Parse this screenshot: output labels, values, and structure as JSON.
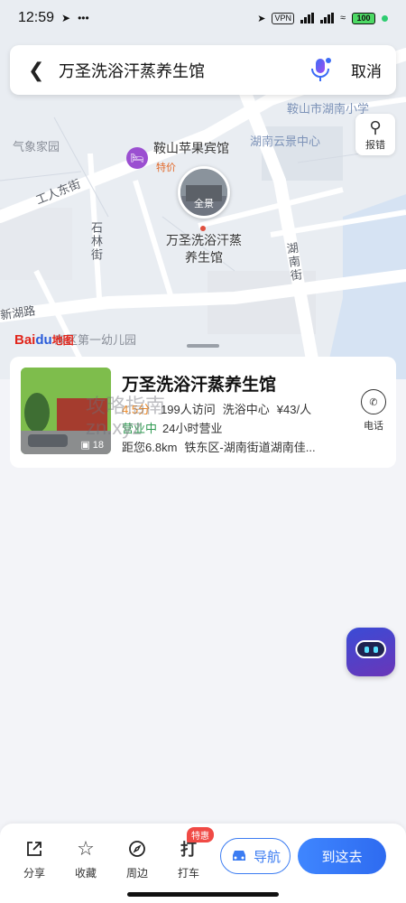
{
  "status_bar": {
    "time": "12:59",
    "left_icons": [
      "navigation-icon",
      "more-icon"
    ],
    "vpn_label": "VPN",
    "battery": "100"
  },
  "search": {
    "query": "万圣洗浴汗蒸养生馆",
    "cancel_label": "取消"
  },
  "map": {
    "report_label": "报错",
    "labels": {
      "weather_park": "气象家园",
      "school": "鞍山市湖南小学",
      "community": "湖南云景中心",
      "street_gongren": "工人东街",
      "street_shilin": "石林街",
      "street_hunan": "湖南街",
      "road_xinhu": "新湖路",
      "kindergarten": "东区第一幼儿园"
    },
    "hotel": {
      "name": "鞍山苹果宾馆",
      "tag": "特价"
    },
    "poi": {
      "name": "万圣洗浴汗蒸养生馆",
      "pano_label": "全景"
    },
    "logo_text": "Bai",
    "logo_paw": "du",
    "logo_suffix": "地图"
  },
  "result": {
    "title": "万圣洗浴汗蒸养生馆",
    "rating": "4.5分",
    "visits": "199人访问",
    "category": "洗浴中心",
    "price": "¥43/人",
    "hours_tag": "营业中",
    "hours": "24小时营业",
    "distance": "距您6.8km",
    "address": "铁东区-湖南街道湖南佳...",
    "photo_count": "18",
    "phone_label": "电话"
  },
  "watermark": {
    "line1": "攻略指南",
    "line2": "zn.xyz"
  },
  "bottom_bar": {
    "share_label": "分享",
    "favorite_label": "收藏",
    "nearby_label": "周边",
    "taxi_label": "打车",
    "promo_badge": "特惠",
    "navigate_label": "导航",
    "go_label": "到这去"
  }
}
